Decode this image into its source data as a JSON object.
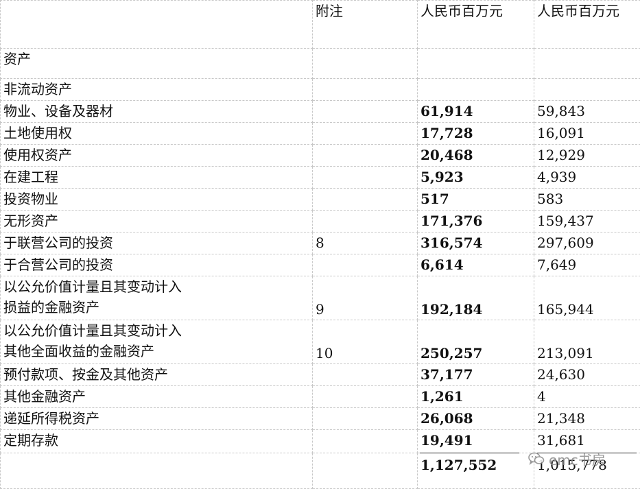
{
  "header": {
    "note": "附注",
    "current": "人民币百万元",
    "previous": "人民币百万元"
  },
  "sections": {
    "assets": "资产",
    "non_current": "非流动资产"
  },
  "rows": [
    {
      "label": "物业、设备及器材",
      "note": "",
      "current": "61,914",
      "previous": "59,843"
    },
    {
      "label": "土地使用权",
      "note": "",
      "current": "17,728",
      "previous": "16,091"
    },
    {
      "label": "使用权资产",
      "note": "",
      "current": "20,468",
      "previous": "12,929"
    },
    {
      "label": "在建工程",
      "note": "",
      "current": "5,923",
      "previous": "4,939"
    },
    {
      "label": "投资物业",
      "note": "",
      "current": "517",
      "previous": "583"
    },
    {
      "label": "无形资产",
      "note": "",
      "current": "171,376",
      "previous": "159,437"
    },
    {
      "label": "于联营公司的投资",
      "note": "8",
      "current": "316,574",
      "previous": "297,609"
    },
    {
      "label": "于合营公司的投资",
      "note": "",
      "current": "6,614",
      "previous": "7,649"
    },
    {
      "label_line1": "以公允价值计量且其变动计入",
      "label_line2": "损益的金融资产",
      "note": "9",
      "current": "192,184",
      "previous": "165,944"
    },
    {
      "label_line1": "以公允价值计量且其变动计入",
      "label_line2": "其他全面收益的金融资产",
      "note": "10",
      "current": "250,257",
      "previous": "213,091"
    },
    {
      "label": "预付款项、按金及其他资产",
      "note": "",
      "current": "37,177",
      "previous": "24,630"
    },
    {
      "label": "其他金融资产",
      "note": "",
      "current": "1,261",
      "previous": "4"
    },
    {
      "label": "递延所得税资产",
      "note": "",
      "current": "26,068",
      "previous": "21,348"
    },
    {
      "label": "定期存款",
      "note": "",
      "current": "19,491",
      "previous": "31,681"
    }
  ],
  "total": {
    "current": "1,127,552",
    "previous": "1,015,778"
  },
  "watermark": {
    "text": "emc书房",
    "icon": "wechat-icon"
  }
}
